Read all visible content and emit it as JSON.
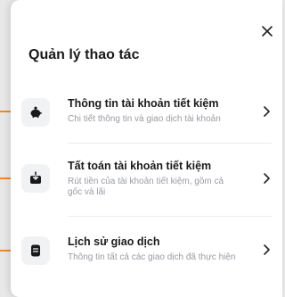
{
  "panel": {
    "title": "Quản lý thao tác",
    "close_icon": "close-icon"
  },
  "items": [
    {
      "title": "Thông tin tài khoản tiết kiệm",
      "description": "Chi tiết thông tin và giao dịch tài khoản",
      "icon": "piggy-bank-icon"
    },
    {
      "title": "Tất toán tài khoản tiết kiệm",
      "description": "Rút tiền của tài khoản tiết kiệm, gồm cả gốc và lãi",
      "icon": "withdraw-box-icon"
    },
    {
      "title": "Lịch sử giao dịch",
      "description": "Thông tin tất cả các giao dịch đã thực hiện",
      "icon": "history-list-icon"
    }
  ],
  "colors": {
    "accent_marker": "#f08a24",
    "icon_background": "#f1f2f4",
    "description_text": "#9a9ca2"
  }
}
